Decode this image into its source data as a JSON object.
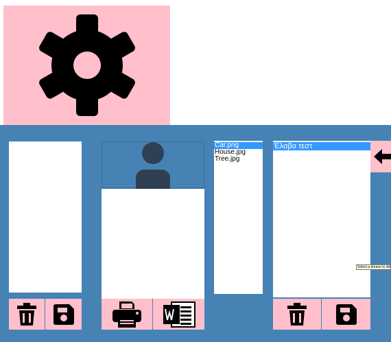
{
  "image_list": {
    "items": [
      "Car.png",
      "House.jpg",
      "Tree.jpg"
    ],
    "selected_index": 0
  },
  "phrase_list": {
    "items": [
      "Έλαβα τεστ"
    ],
    "selected_index": 0
  },
  "tooltip": {
    "text": "Select a phrase to delete"
  },
  "colors": {
    "panel_background": "#4682b4",
    "button_background": "#ffc0cb",
    "selection": "#3399ff",
    "icon": "#000000"
  },
  "icons": {
    "settings": "gear-icon",
    "back": "arrow-left-icon",
    "delete": "trash-icon",
    "save": "floppy-disk-icon",
    "print": "printer-icon",
    "word": "word-document-icon",
    "avatar": "person-icon"
  }
}
